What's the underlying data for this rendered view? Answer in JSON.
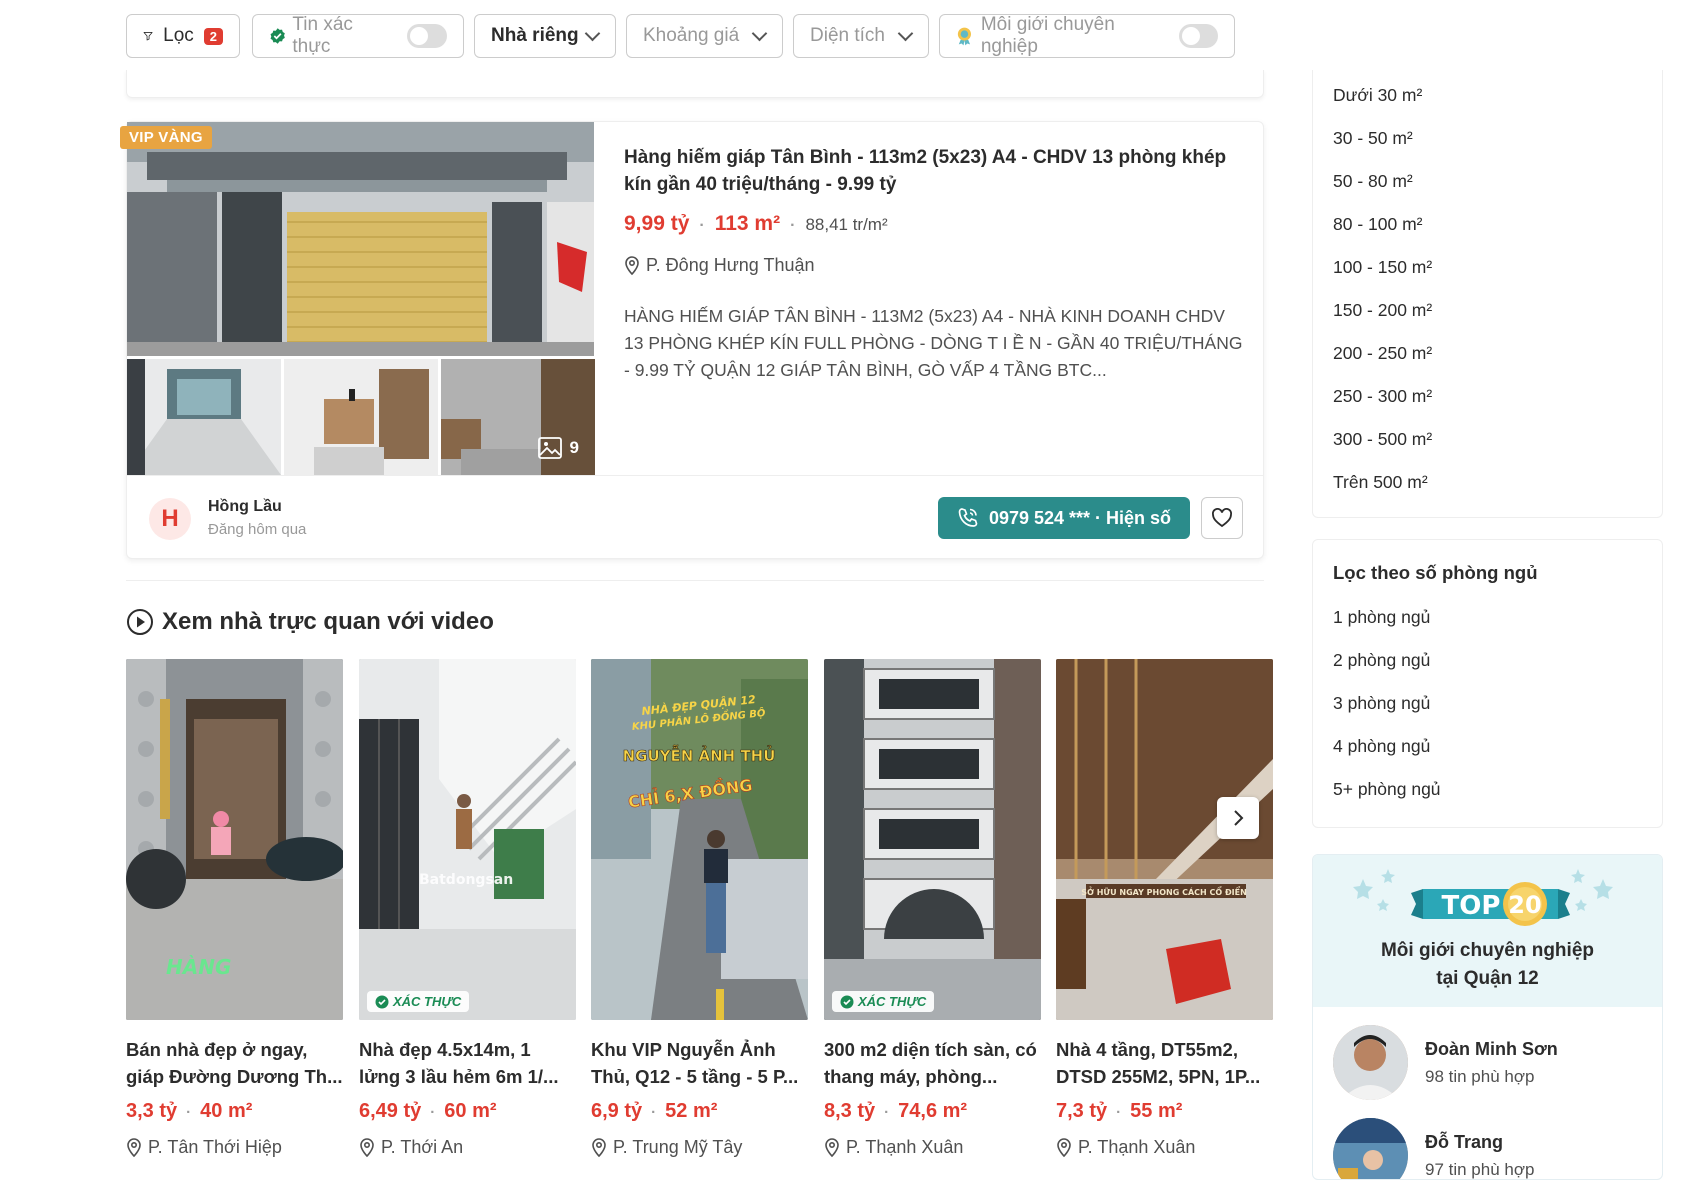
{
  "filters": {
    "filter_label": "Lọc",
    "filter_count": "2",
    "verified_label": "Tin xác thực",
    "property_type": "Nhà riêng",
    "price_range": "Khoảng giá",
    "area": "Diện tích",
    "pro_agent_label": "Môi giới chuyên nghiệp"
  },
  "listing": {
    "badge": "VIP VÀNG",
    "title": "Hàng hiếm giáp Tân Bình - 113m2 (5x23) A4 - CHDV 13 phòng khép kín gần 40 triệu/tháng - 9.99 tỷ",
    "price": "9,99 tỷ",
    "area": "113 m²",
    "price_per_m2": "88,41 tr/m²",
    "location": "P. Đông Hưng Thuận",
    "description": "HÀNG HIẾM GIÁP TÂN BÌNH - 113M2 (5x23) A4 - NHÀ KINH DOANH CHDV 13 PHÒNG KHÉP KÍN FULL PHÒNG - DÒNG T I Ề N - GẦN 40 TRIỆU/THÁNG - 9.99 TỶ QUẬN 12 GIÁP TÂN BÌNH, GÒ VẤP 4 TẦNG BTC...",
    "image_count": "9",
    "agent_initial": "H",
    "agent_name": "Hồng Lầu",
    "posted": "Đăng hôm qua",
    "phone_button": "0979 524 *** · Hiện số"
  },
  "video_section": {
    "heading": "Xem nhà trực quan với video",
    "verified_badge": "XÁC THỰC",
    "items": [
      {
        "title": "Bán nhà đẹp ở ngay, giáp Đường Dương Th...",
        "price": "3,3 tỷ",
        "area": "40 m²",
        "location": "P. Tân Thới Hiệp",
        "verified": false
      },
      {
        "title": "Nhà đẹp 4.5x14m, 1 lửng 3 lầu hẻm 6m 1/...",
        "price": "6,49 tỷ",
        "area": "60 m²",
        "location": "P. Thới An",
        "verified": true
      },
      {
        "title": "Khu VIP Nguyễn Ảnh Thủ, Q12 - 5 tầng - 5 P...",
        "price": "6,9 tỷ",
        "area": "52 m²",
        "location": "P. Trung Mỹ Tây",
        "verified": false
      },
      {
        "title": "300 m2 diện tích sàn, có thang máy, phòng...",
        "price": "8,3 tỷ",
        "area": "74,6 m²",
        "location": "P. Thạnh Xuân",
        "verified": true
      },
      {
        "title": "Nhà 4 tầng, DT55m2, DTSD 255M2, 5PN, 1P...",
        "price": "7,3 tỷ",
        "area": "55 m²",
        "location": "P. Thạnh Xuân",
        "verified": false
      }
    ],
    "overlay_texts": {
      "v3_line1": "NHÀ ĐẸP QUẬN 12",
      "v3_line2": "KHU PHÂN LÔ ĐỒNG BỘ",
      "v3_line3": "NGUYỄN ẢNH THỦ",
      "v3_line4": "CHỈ 6,X ĐỒNG",
      "v2_watermark": "Batdongsan",
      "v5_caption": "SỞ HỮU NGAY PHONG CÁCH CỔ ĐIỂN"
    }
  },
  "sidebar": {
    "area_options": [
      "Dưới 30 m²",
      "30 - 50 m²",
      "50 - 80 m²",
      "80 - 100 m²",
      "100 - 150 m²",
      "150 - 200 m²",
      "200 - 250 m²",
      "250 - 300 m²",
      "300 - 500 m²",
      "Trên 500 m²"
    ],
    "bedroom_title": "Lọc theo số phòng ngủ",
    "bedroom_options": [
      "1 phòng ngủ",
      "2 phòng ngủ",
      "3 phòng ngủ",
      "4 phòng ngủ",
      "5+ phòng ngủ"
    ],
    "top20_word": "TOP",
    "top20_num": "20",
    "top20_line1": "Môi giới chuyên nghiệp",
    "top20_line2": "tại Quận 12",
    "agents": [
      {
        "name": "Đoàn Minh Sơn",
        "count": "98 tin phù hợp"
      },
      {
        "name": "Đỗ Trang",
        "count": "97 tin phù hợp"
      }
    ]
  },
  "colors": {
    "accent_red": "#e03c31",
    "teal_button": "#2b8c8b",
    "vip_gold": "#e8a441"
  }
}
